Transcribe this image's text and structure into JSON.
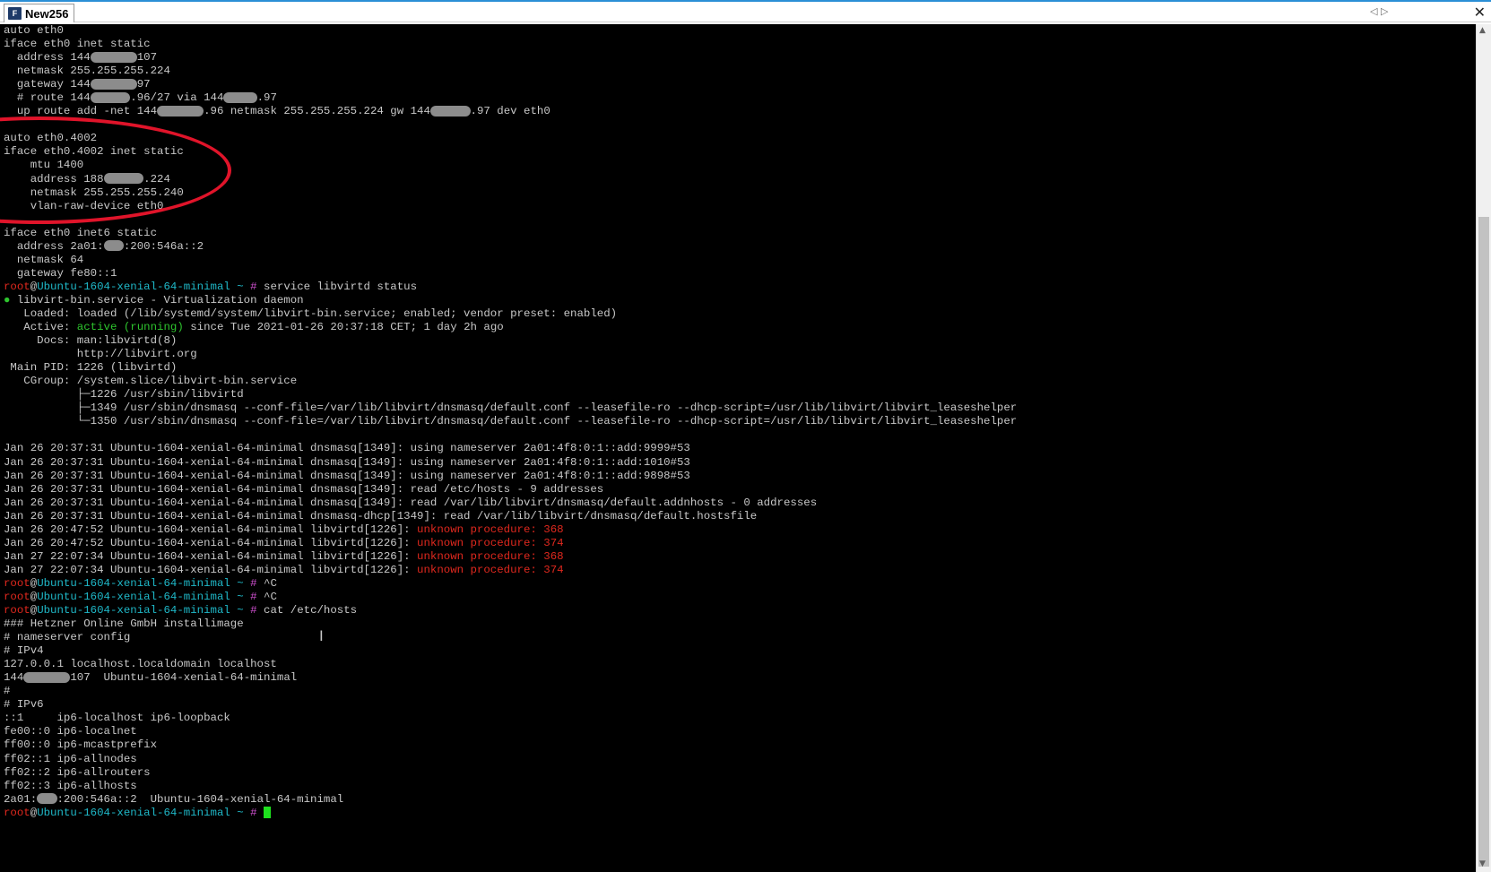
{
  "window": {
    "tab_title": "New256",
    "app_icon_label": "F",
    "nav_left": "◁",
    "nav_right": "▷",
    "close": "✕"
  },
  "colors": {
    "terminal_bg": "#000000",
    "default_text": "#c8c8c8",
    "prompt_user": "#e0281e",
    "prompt_host": "#1fb8c8",
    "prompt_hash": "#d050d0",
    "status_active": "#2ec52e",
    "error_text": "#e0281e",
    "cursor": "#1ee01e",
    "annotation_ellipse": "#e0142a"
  },
  "terminal": {
    "cursor_label": "I",
    "lines": [
      [
        {
          "t": "auto eth0",
          "c": "dim"
        }
      ],
      [
        {
          "t": "iface eth0 inet static",
          "c": "dim"
        }
      ],
      [
        {
          "t": "  address 144",
          "c": "dim"
        },
        {
          "t": "       ",
          "c": "redact"
        },
        {
          "t": "107",
          "c": "dim"
        }
      ],
      [
        {
          "t": "  netmask 255.255.255.224",
          "c": "dim"
        }
      ],
      [
        {
          "t": "  gateway 144",
          "c": "dim"
        },
        {
          "t": "       ",
          "c": "redact"
        },
        {
          "t": "97",
          "c": "dim"
        }
      ],
      [
        {
          "t": "  # route 144",
          "c": "dim"
        },
        {
          "t": "      ",
          "c": "redact"
        },
        {
          "t": ".96/27 via 144",
          "c": "dim"
        },
        {
          "t": "     ",
          "c": "redact"
        },
        {
          "t": ".97",
          "c": "dim"
        }
      ],
      [
        {
          "t": "  up route add -net 144",
          "c": "dim"
        },
        {
          "t": "       ",
          "c": "redact"
        },
        {
          "t": ".96 netmask 255.255.255.224 gw 144",
          "c": "dim"
        },
        {
          "t": "      ",
          "c": "redact"
        },
        {
          "t": ".97 dev eth0",
          "c": "dim"
        }
      ],
      [
        {
          "t": "",
          "c": "dim"
        }
      ],
      [
        {
          "t": "auto eth0.4002",
          "c": "dim"
        }
      ],
      [
        {
          "t": "iface eth0.4002 inet static",
          "c": "dim"
        }
      ],
      [
        {
          "t": "    mtu 1400",
          "c": "dim"
        }
      ],
      [
        {
          "t": "    address 188",
          "c": "dim"
        },
        {
          "t": "      ",
          "c": "redact"
        },
        {
          "t": ".224",
          "c": "dim"
        }
      ],
      [
        {
          "t": "    netmask 255.255.255.240",
          "c": "dim"
        }
      ],
      [
        {
          "t": "    vlan-raw-device eth0",
          "c": "dim"
        }
      ],
      [
        {
          "t": "",
          "c": "dim"
        }
      ],
      [
        {
          "t": "iface eth0 inet6 static",
          "c": "dim"
        }
      ],
      [
        {
          "t": "  address 2a01:",
          "c": "dim"
        },
        {
          "t": "   ",
          "c": "redact"
        },
        {
          "t": ":200:546a::2",
          "c": "dim"
        }
      ],
      [
        {
          "t": "  netmask 64",
          "c": "dim"
        }
      ],
      [
        {
          "t": "  gateway fe80::1",
          "c": "dim"
        }
      ],
      [
        {
          "t": "root",
          "c": "red"
        },
        {
          "t": "@",
          "c": "dim"
        },
        {
          "t": "Ubuntu-1604-xenial-64-minimal ~ ",
          "c": "cyan"
        },
        {
          "t": "#",
          "c": "magenta"
        },
        {
          "t": " service libvirtd status",
          "c": "dim"
        }
      ],
      [
        {
          "t": "● ",
          "c": "green"
        },
        {
          "t": "libvirt-bin.service - Virtualization daemon",
          "c": "dim"
        }
      ],
      [
        {
          "t": "   Loaded: loaded (/lib/systemd/system/libvirt-bin.service; enabled; vendor preset: enabled)",
          "c": "dim"
        }
      ],
      [
        {
          "t": "   Active: ",
          "c": "dim"
        },
        {
          "t": "active (running)",
          "c": "green"
        },
        {
          "t": " since Tue 2021-01-26 20:37:18 CET; 1 day 2h ago",
          "c": "dim"
        }
      ],
      [
        {
          "t": "     Docs: man:libvirtd(8)",
          "c": "dim"
        }
      ],
      [
        {
          "t": "           http://libvirt.org",
          "c": "dim"
        }
      ],
      [
        {
          "t": " Main PID: 1226 (libvirtd)",
          "c": "dim"
        }
      ],
      [
        {
          "t": "   CGroup: /system.slice/libvirt-bin.service",
          "c": "dim"
        }
      ],
      [
        {
          "t": "           ├─1226 /usr/sbin/libvirtd",
          "c": "dim"
        }
      ],
      [
        {
          "t": "           ├─1349 /usr/sbin/dnsmasq --conf-file=/var/lib/libvirt/dnsmasq/default.conf --leasefile-ro --dhcp-script=/usr/lib/libvirt/libvirt_leaseshelper",
          "c": "dim"
        }
      ],
      [
        {
          "t": "           └─1350 /usr/sbin/dnsmasq --conf-file=/var/lib/libvirt/dnsmasq/default.conf --leasefile-ro --dhcp-script=/usr/lib/libvirt/libvirt_leaseshelper",
          "c": "dim"
        }
      ],
      [
        {
          "t": "",
          "c": "dim"
        }
      ],
      [
        {
          "t": "Jan 26 20:37:31 Ubuntu-1604-xenial-64-minimal dnsmasq[1349]: using nameserver 2a01:4f8:0:1::add:9999#53",
          "c": "dim"
        }
      ],
      [
        {
          "t": "Jan 26 20:37:31 Ubuntu-1604-xenial-64-minimal dnsmasq[1349]: using nameserver 2a01:4f8:0:1::add:1010#53",
          "c": "dim"
        }
      ],
      [
        {
          "t": "Jan 26 20:37:31 Ubuntu-1604-xenial-64-minimal dnsmasq[1349]: using nameserver 2a01:4f8:0:1::add:9898#53",
          "c": "dim"
        }
      ],
      [
        {
          "t": "Jan 26 20:37:31 Ubuntu-1604-xenial-64-minimal dnsmasq[1349]: read /etc/hosts - 9 addresses",
          "c": "dim"
        }
      ],
      [
        {
          "t": "Jan 26 20:37:31 Ubuntu-1604-xenial-64-minimal dnsmasq[1349]: read /var/lib/libvirt/dnsmasq/default.addnhosts - 0 addresses",
          "c": "dim"
        }
      ],
      [
        {
          "t": "Jan 26 20:37:31 Ubuntu-1604-xenial-64-minimal dnsmasq-dhcp[1349]: read /var/lib/libvirt/dnsmasq/default.hostsfile",
          "c": "dim"
        }
      ],
      [
        {
          "t": "Jan 26 20:47:52 Ubuntu-1604-xenial-64-minimal libvirtd[1226]: ",
          "c": "dim"
        },
        {
          "t": "unknown procedure: 368",
          "c": "red"
        }
      ],
      [
        {
          "t": "Jan 26 20:47:52 Ubuntu-1604-xenial-64-minimal libvirtd[1226]: ",
          "c": "dim"
        },
        {
          "t": "unknown procedure: 374",
          "c": "red"
        }
      ],
      [
        {
          "t": "Jan 27 22:07:34 Ubuntu-1604-xenial-64-minimal libvirtd[1226]: ",
          "c": "dim"
        },
        {
          "t": "unknown procedure: 368",
          "c": "red"
        }
      ],
      [
        {
          "t": "Jan 27 22:07:34 Ubuntu-1604-xenial-64-minimal libvirtd[1226]: ",
          "c": "dim"
        },
        {
          "t": "unknown procedure: 374",
          "c": "red"
        }
      ],
      [
        {
          "t": "root",
          "c": "red"
        },
        {
          "t": "@",
          "c": "dim"
        },
        {
          "t": "Ubuntu-1604-xenial-64-minimal ~ ",
          "c": "cyan"
        },
        {
          "t": "#",
          "c": "magenta"
        },
        {
          "t": " ^C",
          "c": "dim"
        }
      ],
      [
        {
          "t": "root",
          "c": "red"
        },
        {
          "t": "@",
          "c": "dim"
        },
        {
          "t": "Ubuntu-1604-xenial-64-minimal ~ ",
          "c": "cyan"
        },
        {
          "t": "#",
          "c": "magenta"
        },
        {
          "t": " ^C",
          "c": "dim"
        }
      ],
      [
        {
          "t": "root",
          "c": "red"
        },
        {
          "t": "@",
          "c": "dim"
        },
        {
          "t": "Ubuntu-1604-xenial-64-minimal ~ ",
          "c": "cyan"
        },
        {
          "t": "#",
          "c": "magenta"
        },
        {
          "t": " cat /etc/hosts",
          "c": "dim"
        }
      ],
      [
        {
          "t": "### Hetzner Online GmbH installimage",
          "c": "dim"
        }
      ],
      [
        {
          "t": "# nameserver config",
          "c": "dim"
        }
      ],
      [
        {
          "t": "# IPv4",
          "c": "dim"
        }
      ],
      [
        {
          "t": "127.0.0.1 localhost.localdomain localhost",
          "c": "dim"
        }
      ],
      [
        {
          "t": "144",
          "c": "dim"
        },
        {
          "t": "       ",
          "c": "redact"
        },
        {
          "t": "107  Ubuntu-1604-xenial-64-minimal",
          "c": "dim"
        }
      ],
      [
        {
          "t": "#",
          "c": "dim"
        }
      ],
      [
        {
          "t": "# IPv6",
          "c": "dim"
        }
      ],
      [
        {
          "t": "::1     ip6-localhost ip6-loopback",
          "c": "dim"
        }
      ],
      [
        {
          "t": "fe00::0 ip6-localnet",
          "c": "dim"
        }
      ],
      [
        {
          "t": "ff00::0 ip6-mcastprefix",
          "c": "dim"
        }
      ],
      [
        {
          "t": "ff02::1 ip6-allnodes",
          "c": "dim"
        }
      ],
      [
        {
          "t": "ff02::2 ip6-allrouters",
          "c": "dim"
        }
      ],
      [
        {
          "t": "ff02::3 ip6-allhosts",
          "c": "dim"
        }
      ],
      [
        {
          "t": "2a01:",
          "c": "dim"
        },
        {
          "t": "   ",
          "c": "redact"
        },
        {
          "t": ":200:546a::2  Ubuntu-1604-xenial-64-minimal",
          "c": "dim"
        }
      ],
      [
        {
          "t": "root",
          "c": "red"
        },
        {
          "t": "@",
          "c": "dim"
        },
        {
          "t": "Ubuntu-1604-xenial-64-minimal ~ ",
          "c": "cyan"
        },
        {
          "t": "#",
          "c": "magenta"
        },
        {
          "t": " ",
          "c": "dim"
        },
        {
          "t": "",
          "c": "cursor"
        }
      ]
    ]
  }
}
